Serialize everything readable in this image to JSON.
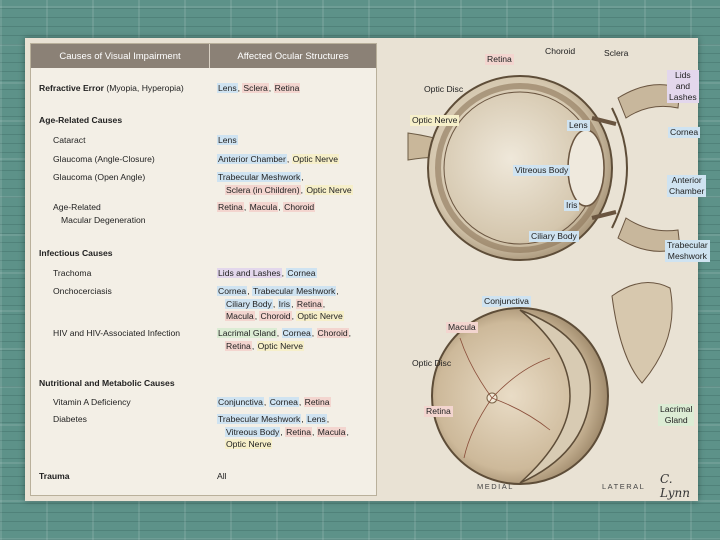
{
  "table": {
    "header_causes": "Causes of Visual Impairment",
    "header_structures": "Affected Ocular Structures",
    "refractive": {
      "cause_bold": "Refractive Error",
      "cause_rest": " (Myopia, Hyperopia)",
      "s1": "Lens",
      "s2": "Sclera",
      "s3": "Retina"
    },
    "age_heading": "Age-Related Causes",
    "cataract": {
      "cause": "Cataract",
      "s1": "Lens"
    },
    "glaucoma_closure": {
      "cause": "Glaucoma (Angle-Closure)",
      "s1": "Anterior Chamber",
      "s2": "Optic Nerve"
    },
    "glaucoma_open": {
      "cause": "Glaucoma (Open Angle)",
      "s1": "Trabecular Meshwork",
      "s2": "Sclera (in Children)",
      "s3": "Optic Nerve"
    },
    "amd": {
      "cause_l1": "Age-Related",
      "cause_l2": "Macular Degeneration",
      "s1": "Retina",
      "s2": "Macula",
      "s3": "Choroid"
    },
    "infectious_heading": "Infectious Causes",
    "trachoma": {
      "cause": "Trachoma",
      "s1": "Lids and Lashes",
      "s2": "Cornea"
    },
    "onchocerciasis": {
      "cause": "Onchocerciasis",
      "s1": "Cornea",
      "s2": "Trabecular Meshwork",
      "s3": "Ciliary Body",
      "s4": "Iris",
      "s5": "Retina",
      "s6": "Macula",
      "s7": "Choroid",
      "s8": "Optic Nerve"
    },
    "hiv": {
      "cause": "HIV and HIV-Associated Infection",
      "s1": "Lacrimal Gland",
      "s2": "Cornea",
      "s3": "Choroid",
      "s4": "Retina",
      "s5": "Optic Nerve"
    },
    "nutritional_heading": "Nutritional and Metabolic Causes",
    "vitamin_a": {
      "cause": "Vitamin A Deficiency",
      "s1": "Conjunctiva",
      "s2": "Cornea",
      "s3": "Retina"
    },
    "diabetes": {
      "cause": "Diabetes",
      "s1": "Trabecular Meshwork",
      "s2": "Lens",
      "s3": "Vitreous Body",
      "s4": "Retina",
      "s5": "Macula",
      "s6": "Optic Nerve"
    },
    "trauma": {
      "cause": "Trauma",
      "s1": "All"
    }
  },
  "labels": {
    "choroid": "Choroid",
    "sclera": "Sclera",
    "retina_top": "Retina",
    "lids_lashes_1": "Lids and",
    "lids_lashes_2": "Lashes",
    "optic_disc_top": "Optic Disc",
    "optic_nerve": "Optic Nerve",
    "lens": "Lens",
    "cornea": "Cornea",
    "vitreous_body": "Vitreous Body",
    "anterior_chamber_1": "Anterior",
    "anterior_chamber_2": "Chamber",
    "iris": "Iris",
    "ciliary_body": "Ciliary Body",
    "trabecular_1": "Trabecular",
    "trabecular_2": "Meshwork",
    "conjunctiva": "Conjunctiva",
    "macula": "Macula",
    "optic_disc_bottom": "Optic Disc",
    "retina_bottom": "Retina",
    "lacrimal_1": "Lacrimal",
    "lacrimal_2": "Gland",
    "medial": "MEDIAL",
    "lateral": "LATERAL",
    "signature": "C. Lynn"
  },
  "colors": {
    "blue": "#cfe3f1",
    "pink": "#f3d5cf",
    "yellow": "#f6efc9",
    "purple": "#e3d7ec",
    "header": "#8b8176"
  }
}
